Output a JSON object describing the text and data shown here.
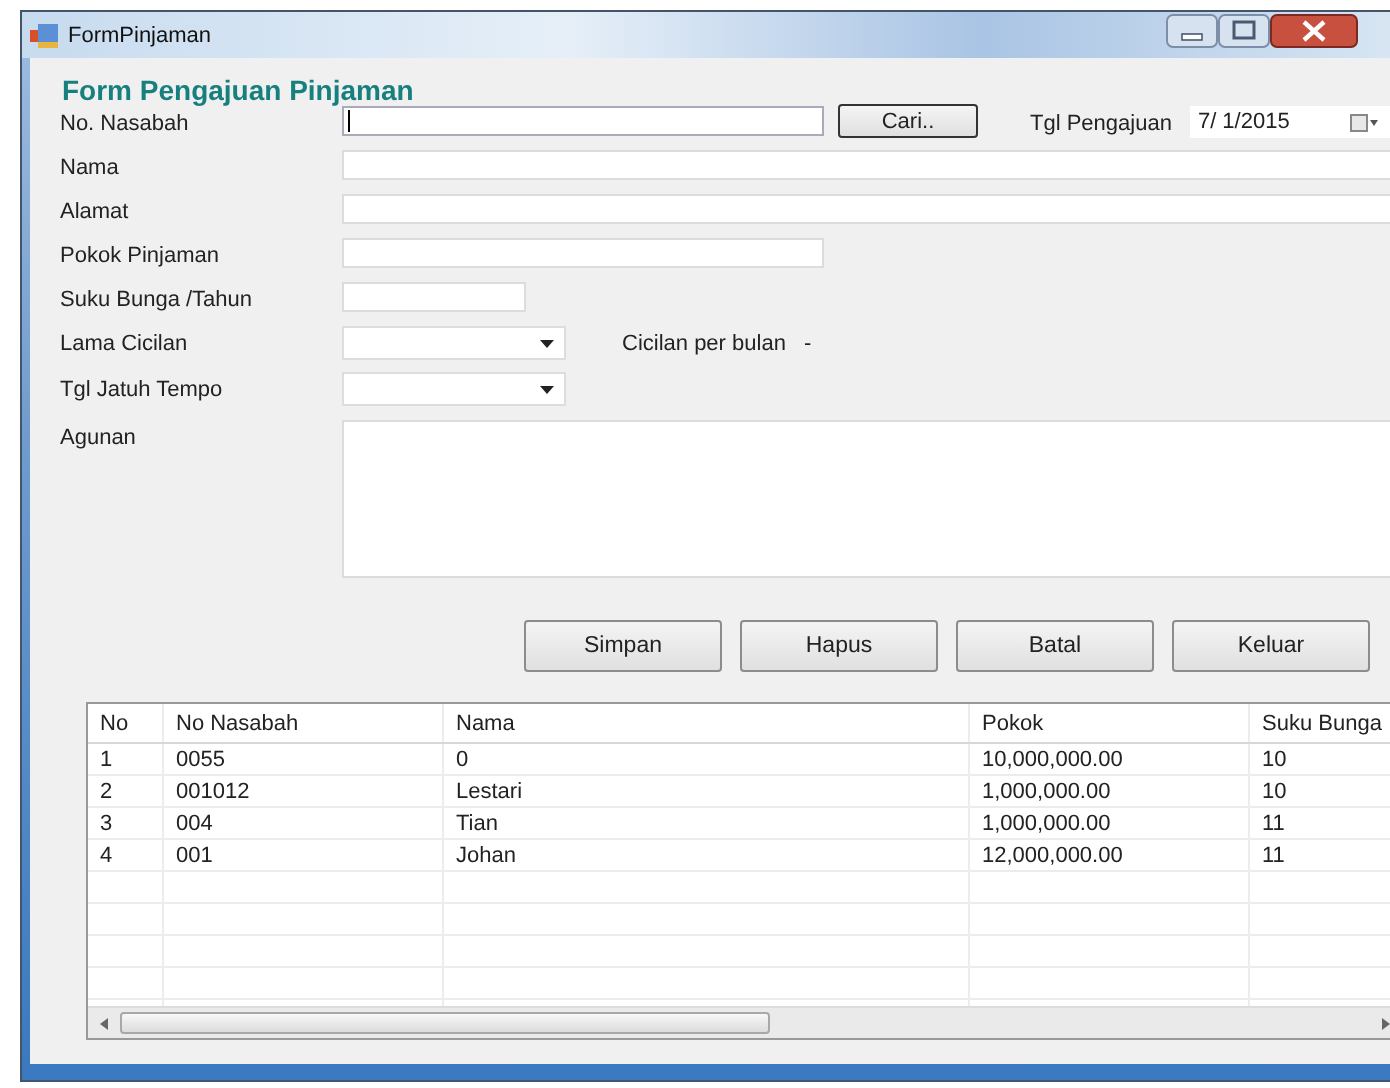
{
  "window": {
    "title": "FormPinjaman"
  },
  "heading": "Form Pengajuan Pinjaman",
  "form_rows": [
    {
      "label": "No. Nasabah",
      "items": [
        {
          "kind": "text",
          "focused": true
        },
        {
          "kind": "button",
          "label": "Cari.."
        },
        {
          "kind": "label",
          "text": "Tgl Pengajuan"
        },
        {
          "kind": "date",
          "value": "7/ 1/2015"
        }
      ]
    },
    {
      "label": "Nama",
      "items": [
        {
          "kind": "text",
          "focused": false
        }
      ]
    },
    {
      "label": "Alamat",
      "items": [
        {
          "kind": "text",
          "focused": false
        }
      ]
    },
    {
      "label": "Pokok Pinjaman",
      "items": [
        {
          "kind": "text",
          "focused": false
        }
      ]
    },
    {
      "label": "Suku Bunga /Tahun",
      "items": [
        {
          "kind": "text",
          "focused": false
        }
      ]
    },
    {
      "label": "Lama Cicilan",
      "items": [
        {
          "kind": "combo"
        },
        {
          "kind": "label",
          "text": "Cicilan per bulan"
        },
        {
          "kind": "label",
          "text": "-"
        }
      ]
    },
    {
      "label": "Tgl Jatuh Tempo",
      "items": [
        {
          "kind": "combo"
        }
      ]
    },
    {
      "label": "Agunan",
      "items": [
        {
          "kind": "textarea"
        }
      ]
    }
  ],
  "buttons": [
    "Simpan",
    "Hapus",
    "Batal",
    "Keluar"
  ],
  "table": {
    "columns": [
      "No",
      "No Nasabah",
      "Nama",
      "Pokok",
      "Suku Bunga"
    ],
    "rows": [
      [
        "1",
        "0055",
        "0",
        "10,000,000.00",
        "10"
      ],
      [
        "2",
        "001012",
        "Lestari",
        "1,000,000.00",
        "10"
      ],
      [
        "3",
        "004",
        "Tian",
        "1,000,000.00",
        "11"
      ],
      [
        "4",
        "001",
        "Johan",
        "12,000,000.00",
        "11"
      ]
    ]
  }
}
